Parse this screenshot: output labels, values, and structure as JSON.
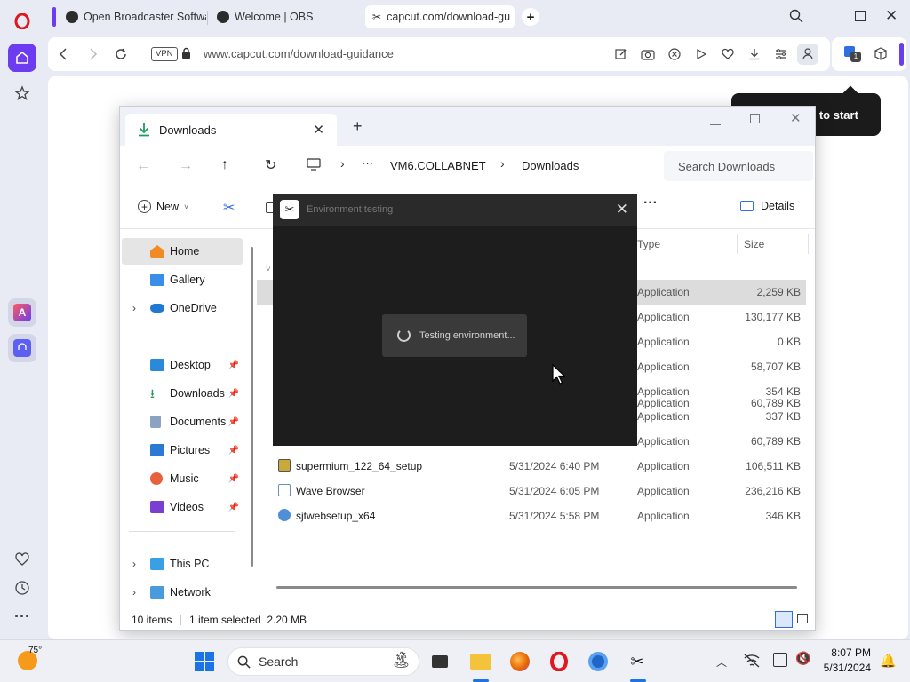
{
  "browser": {
    "tabs": [
      {
        "label": "Open Broadcaster Softwa",
        "active": false
      },
      {
        "label": "Welcome | OBS",
        "active": false
      },
      {
        "label": "capcut.com/download-gu",
        "active": true
      }
    ],
    "vpn_badge": "VPN",
    "url": "www.capcut.com/download-guidance",
    "ext_badge_count": "1"
  },
  "page": {
    "tip_text": "k to start"
  },
  "explorer": {
    "tab_title": "Downloads",
    "breadcrumb": {
      "ellipsis": "···",
      "root": "VM6.COLLABNET",
      "current": "Downloads"
    },
    "search_placeholder": "Search Downloads",
    "toolbar": {
      "new_label": "New",
      "details_label": "Details",
      "more": "···"
    },
    "nav": {
      "home": "Home",
      "gallery": "Gallery",
      "onedrive": "OneDrive",
      "desktop": "Desktop",
      "downloads": "Downloads",
      "documents": "Documents",
      "pictures": "Pictures",
      "music": "Music",
      "videos": "Videos",
      "thispc": "This PC",
      "network": "Network"
    },
    "columns": {
      "type": "Type",
      "size": "Size"
    },
    "rows": [
      {
        "name": "",
        "date": "",
        "type": "Application",
        "size": "2,259 KB",
        "selected": true
      },
      {
        "name": "",
        "date": "",
        "type": "Application",
        "size": "130,177 KB"
      },
      {
        "name": "",
        "date": "",
        "type": "Application",
        "size": "0 KB"
      },
      {
        "name": "",
        "date": "",
        "type": "Application",
        "size": "58,707 KB"
      },
      {
        "name": "",
        "date": "",
        "type": "Application",
        "size": "354 KB"
      },
      {
        "name": "",
        "date": "",
        "type": "Application",
        "size": "337 KB"
      },
      {
        "name": "",
        "date": "",
        "type": "Application",
        "size": "60,789 KB"
      },
      {
        "name": "supermium_122_64_setup",
        "date": "5/31/2024 6:40 PM",
        "type": "Application",
        "size": "106,511 KB"
      },
      {
        "name": "Wave Browser",
        "date": "5/31/2024 6:05 PM",
        "type": "Application",
        "size": "236,216 KB"
      },
      {
        "name": "sjtwebsetup_x64",
        "date": "5/31/2024 5:58 PM",
        "type": "Application",
        "size": "346 KB"
      }
    ],
    "status": {
      "items": "10 items",
      "selected": "1 item selected  2.20 MB"
    }
  },
  "env_dialog": {
    "title": "Environment testing",
    "message": "Testing environment..."
  },
  "taskbar": {
    "weather_temp": "75°",
    "search_label": "Search",
    "time": "8:07 PM",
    "date": "5/31/2024"
  },
  "colors": {
    "opera_red": "#e0171c",
    "opera_accent": "#6b3cf0",
    "selection": "#dcdcdc",
    "dialog_bg": "#1d1d1d"
  }
}
